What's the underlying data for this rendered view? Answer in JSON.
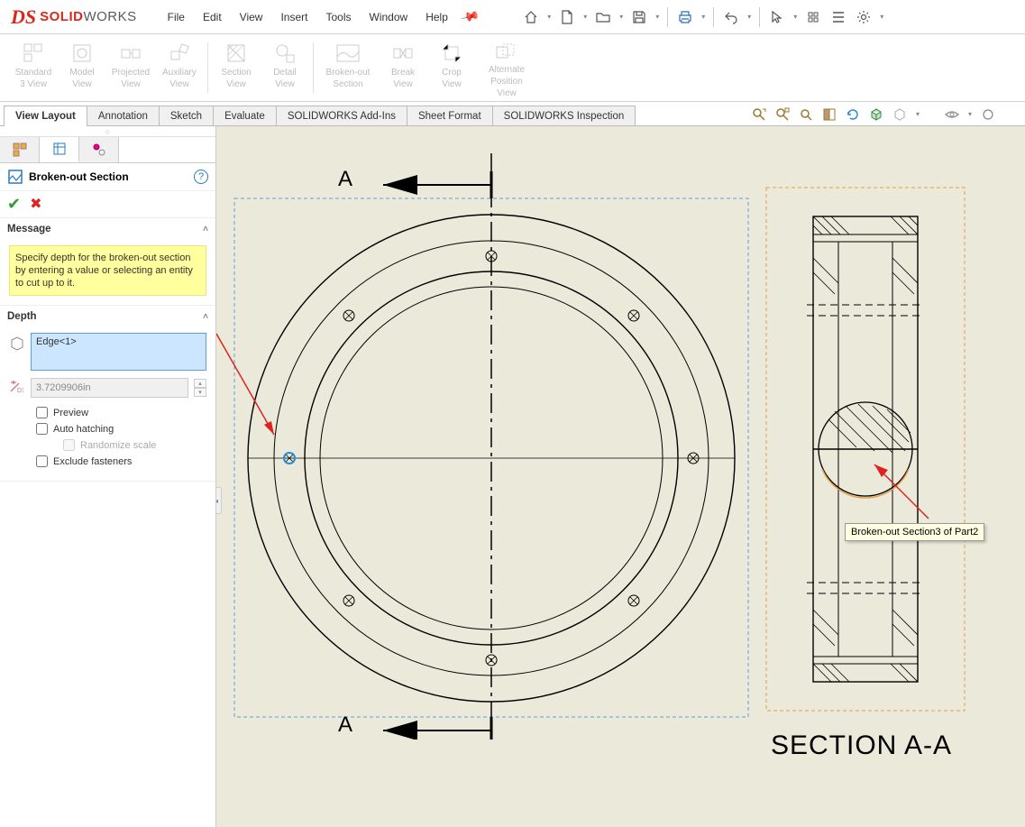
{
  "app": {
    "brand1": "SOLID",
    "brand2": "WORKS"
  },
  "menu": [
    "File",
    "Edit",
    "View",
    "Insert",
    "Tools",
    "Window",
    "Help"
  ],
  "ribbon": [
    {
      "label": "Standard\n3 View"
    },
    {
      "label": "Model\nView"
    },
    {
      "label": "Projected\nView"
    },
    {
      "label": "Auxiliary\nView"
    },
    {
      "sep": true
    },
    {
      "label": "Section\nView"
    },
    {
      "label": "Detail\nView"
    },
    {
      "sep": true
    },
    {
      "label": "Broken-out\nSection",
      "wide": true
    },
    {
      "label": "Break\nView"
    },
    {
      "label": "Crop\nView"
    },
    {
      "label": "Alternate\nPosition\nView",
      "wide": true
    }
  ],
  "tabs": [
    "View Layout",
    "Annotation",
    "Sketch",
    "Evaluate",
    "SOLIDWORKS Add-Ins",
    "Sheet Format",
    "SOLIDWORKS Inspection"
  ],
  "activeTab": 0,
  "feature": {
    "title": "Broken-out Section",
    "message_head": "Message",
    "message": "Specify depth for the broken-out section by entering a value or selecting an entity to cut up to it.",
    "depth_head": "Depth",
    "selection": "Edge<1>",
    "dimension": "3.7209906in",
    "preview": "Preview",
    "autohatch": "Auto hatching",
    "randomize": "Randomize scale",
    "exclude": "Exclude fasteners"
  },
  "drawing": {
    "arrowA1": "A",
    "arrowA2": "A",
    "sectionTitle": "SECTION A-A",
    "tooltip": "Broken-out Section3 of Part2"
  }
}
